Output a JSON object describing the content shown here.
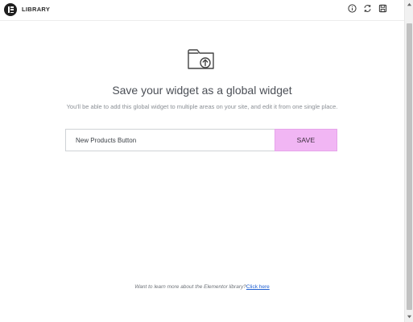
{
  "header": {
    "title": "LIBRARY",
    "icons": [
      "info-icon",
      "sync-icon",
      "save-icon"
    ]
  },
  "main": {
    "icon": "folder-upload-icon",
    "title": "Save your widget as a global widget",
    "subtitle": "You'll be able to add this global widget to multiple areas on your site, and edit it from one single place.",
    "input_value": "New Products Button",
    "save_label": "SAVE"
  },
  "footer": {
    "text": "Want to learn more about the Elementor library?",
    "link": "Click here"
  },
  "colors": {
    "save_button": "#f1b6f4",
    "link": "#1f5fd1",
    "logo": "#1f1f1f"
  }
}
